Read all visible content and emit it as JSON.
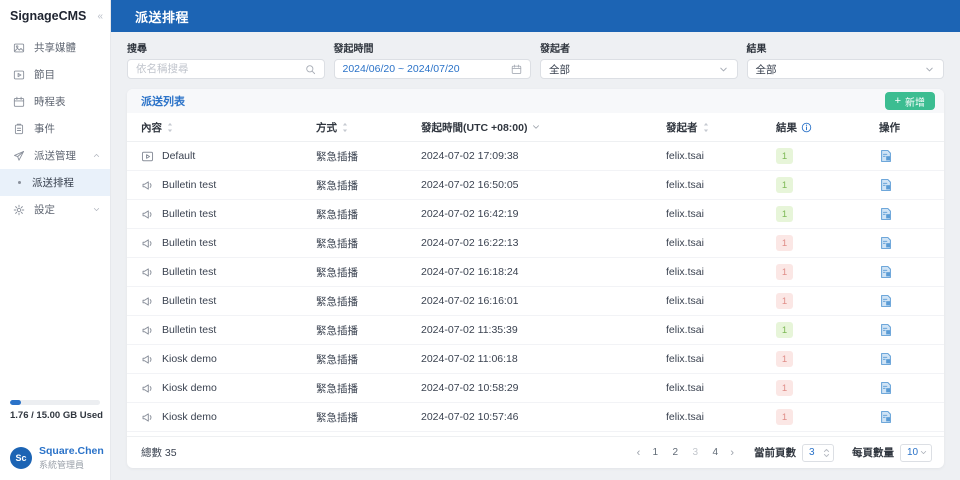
{
  "app": {
    "title": "SignageCMS"
  },
  "colors": {
    "primary_blue": "#1c64b4",
    "link_blue": "#2a72c8",
    "add_button_green": "#3cbd91",
    "badge_success_bg": "#e7f5d9",
    "badge_success_text": "#7cb854",
    "badge_fail_bg": "#fbe7e5",
    "badge_fail_text": "#e08d88"
  },
  "sidebar": {
    "collapse_icon": "«",
    "items": [
      {
        "id": "shared-media",
        "label": "共享媒體",
        "icon": "media"
      },
      {
        "id": "programs",
        "label": "節目",
        "icon": "program"
      },
      {
        "id": "schedules",
        "label": "時程表",
        "icon": "schedule"
      },
      {
        "id": "events",
        "label": "事件",
        "icon": "event"
      },
      {
        "id": "dispatch-management",
        "label": "派送管理",
        "icon": "dispatch",
        "chevron": "up"
      },
      {
        "id": "dispatch-schedule",
        "label": "派送排程",
        "sub": true,
        "active": true
      },
      {
        "id": "settings",
        "label": "設定",
        "icon": "settings",
        "chevron": "down"
      }
    ],
    "storage": {
      "used_label": "1.76 / 15.00 GB Used",
      "percent": 12
    },
    "user": {
      "initials": "Sc",
      "name": "Square.Chen",
      "role": "系統管理員"
    }
  },
  "header": {
    "title": "派送排程"
  },
  "filters": {
    "search": {
      "label": "搜尋",
      "placeholder": "依名稱搜尋"
    },
    "time": {
      "label": "發起時間",
      "value": "2024/06/20 ~ 2024/07/20"
    },
    "initiator": {
      "label": "發起者",
      "value": "全部"
    },
    "result": {
      "label": "結果",
      "value": "全部"
    }
  },
  "table": {
    "title": "派送列表",
    "add_button": "新增",
    "columns": [
      {
        "label": "內容",
        "indicator": "sort"
      },
      {
        "label": "方式",
        "indicator": "sort"
      },
      {
        "label": "發起時間(UTC +08:00)",
        "indicator": "sorted-desc"
      },
      {
        "label": "發起者",
        "indicator": "sort"
      },
      {
        "label": "結果",
        "indicator": "info"
      },
      {
        "label": "操作",
        "indicator": "none"
      }
    ],
    "rows": [
      {
        "name": "Default",
        "icon": "program",
        "method": "緊急插播",
        "time": "2024-07-02 17:09:38",
        "initiator": "felix.tsai",
        "result": "1",
        "result_status": "success"
      },
      {
        "name": "Bulletin test",
        "icon": "megaphone",
        "method": "緊急插播",
        "time": "2024-07-02 16:50:05",
        "initiator": "felix.tsai",
        "result": "1",
        "result_status": "success"
      },
      {
        "name": "Bulletin test",
        "icon": "megaphone",
        "method": "緊急插播",
        "time": "2024-07-02 16:42:19",
        "initiator": "felix.tsai",
        "result": "1",
        "result_status": "success"
      },
      {
        "name": "Bulletin test",
        "icon": "megaphone",
        "method": "緊急插播",
        "time": "2024-07-02 16:22:13",
        "initiator": "felix.tsai",
        "result": "1",
        "result_status": "fail"
      },
      {
        "name": "Bulletin test",
        "icon": "megaphone",
        "method": "緊急插播",
        "time": "2024-07-02 16:18:24",
        "initiator": "felix.tsai",
        "result": "1",
        "result_status": "fail"
      },
      {
        "name": "Bulletin test",
        "icon": "megaphone",
        "method": "緊急插播",
        "time": "2024-07-02 16:16:01",
        "initiator": "felix.tsai",
        "result": "1",
        "result_status": "fail"
      },
      {
        "name": "Bulletin test",
        "icon": "megaphone",
        "method": "緊急插播",
        "time": "2024-07-02 11:35:39",
        "initiator": "felix.tsai",
        "result": "1",
        "result_status": "success"
      },
      {
        "name": "Kiosk demo",
        "icon": "megaphone",
        "method": "緊急插播",
        "time": "2024-07-02 11:06:18",
        "initiator": "felix.tsai",
        "result": "1",
        "result_status": "fail"
      },
      {
        "name": "Kiosk demo",
        "icon": "megaphone",
        "method": "緊急插播",
        "time": "2024-07-02 10:58:29",
        "initiator": "felix.tsai",
        "result": "1",
        "result_status": "fail"
      },
      {
        "name": "Kiosk demo",
        "icon": "megaphone",
        "method": "緊急插播",
        "time": "2024-07-02 10:57:46",
        "initiator": "felix.tsai",
        "result": "1",
        "result_status": "fail"
      }
    ]
  },
  "footer": {
    "total": "總數 35",
    "prev_arrow": "‹",
    "next_arrow": "›",
    "pages": [
      "1",
      "2",
      "3",
      "4"
    ],
    "current_page": "3",
    "current_page_label": "當前頁數",
    "page_size_label": "每頁數量",
    "page_size": "10"
  }
}
